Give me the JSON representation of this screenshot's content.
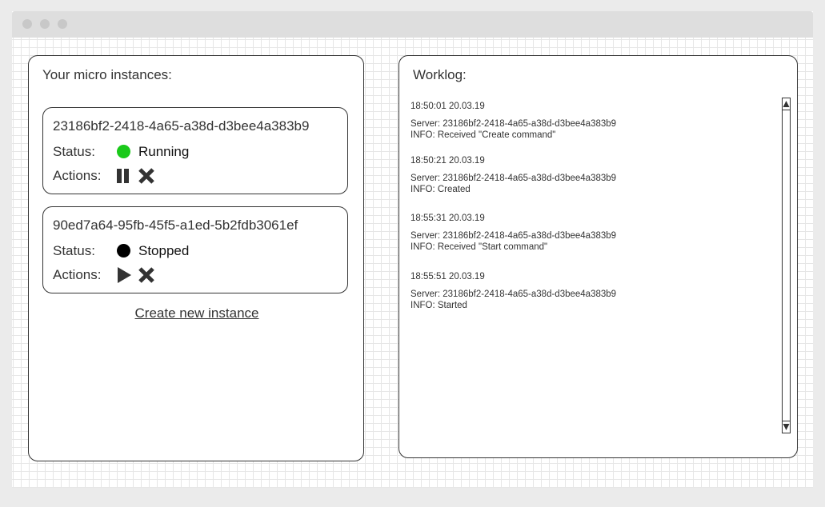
{
  "instances_panel": {
    "title": "Your micro instances:",
    "instances": [
      {
        "id": "23186bf2-2418-4a65-a38d-d3bee4a383b9",
        "status_label": "Status:",
        "status": "Running",
        "status_color": "#1ac91a",
        "actions_label": "Actions:",
        "primary_action_icon": "pause-icon",
        "delete_action_icon": "close-icon"
      },
      {
        "id": "90ed7a64-95fb-45f5-a1ed-5b2fdb3061ef",
        "status_label": "Status:",
        "status": "Stopped",
        "status_color": "#000000",
        "actions_label": "Actions:",
        "primary_action_icon": "play-icon",
        "delete_action_icon": "close-icon"
      }
    ],
    "create_link": "Create new instance"
  },
  "worklog_panel": {
    "title": "Worklog:",
    "entries": [
      {
        "timestamp": "18:50:01 20.03.19",
        "server": "Server: 23186bf2-2418-4a65-a38d-d3bee4a383b9",
        "info": "INFO: Received \"Create command\""
      },
      {
        "timestamp": "18:50:21 20.03.19",
        "server": "Server: 23186bf2-2418-4a65-a38d-d3bee4a383b9",
        "info": "INFO: Created"
      },
      {
        "timestamp": "18:55:31 20.03.19",
        "server": "Server: 23186bf2-2418-4a65-a38d-d3bee4a383b9",
        "info": "INFO: Received \"Start command\""
      },
      {
        "timestamp": "18:55:51 20.03.19",
        "server": "Server: 23186bf2-2418-4a65-a38d-d3bee4a383b9",
        "info": "INFO: Started"
      }
    ]
  }
}
